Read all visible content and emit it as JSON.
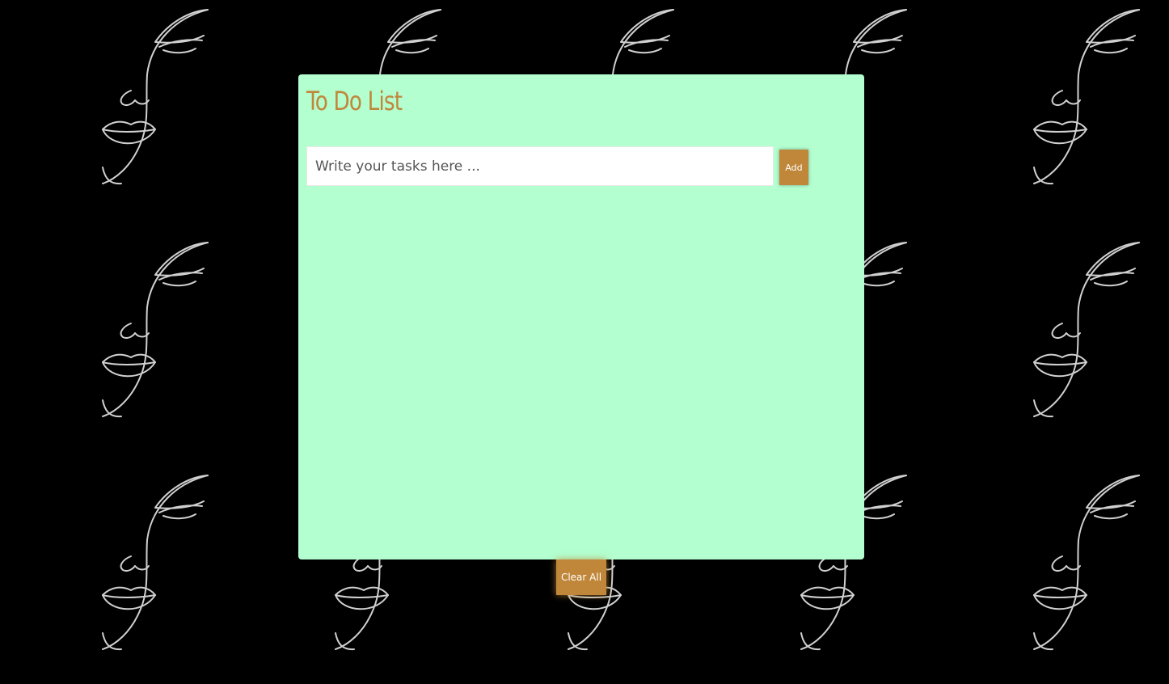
{
  "app": {
    "title": "To Do List"
  },
  "input": {
    "value": "",
    "placeholder": "Write your tasks here ..."
  },
  "buttons": {
    "add_label": "Add",
    "clear_label": "Clear All"
  },
  "tasks": [],
  "colors": {
    "background": "#000000",
    "panel": "#b3ffd0",
    "accent": "#c0873a",
    "line_art": "#d0d0d0"
  },
  "icons": {
    "background_pattern": "face-line-art-icon"
  }
}
